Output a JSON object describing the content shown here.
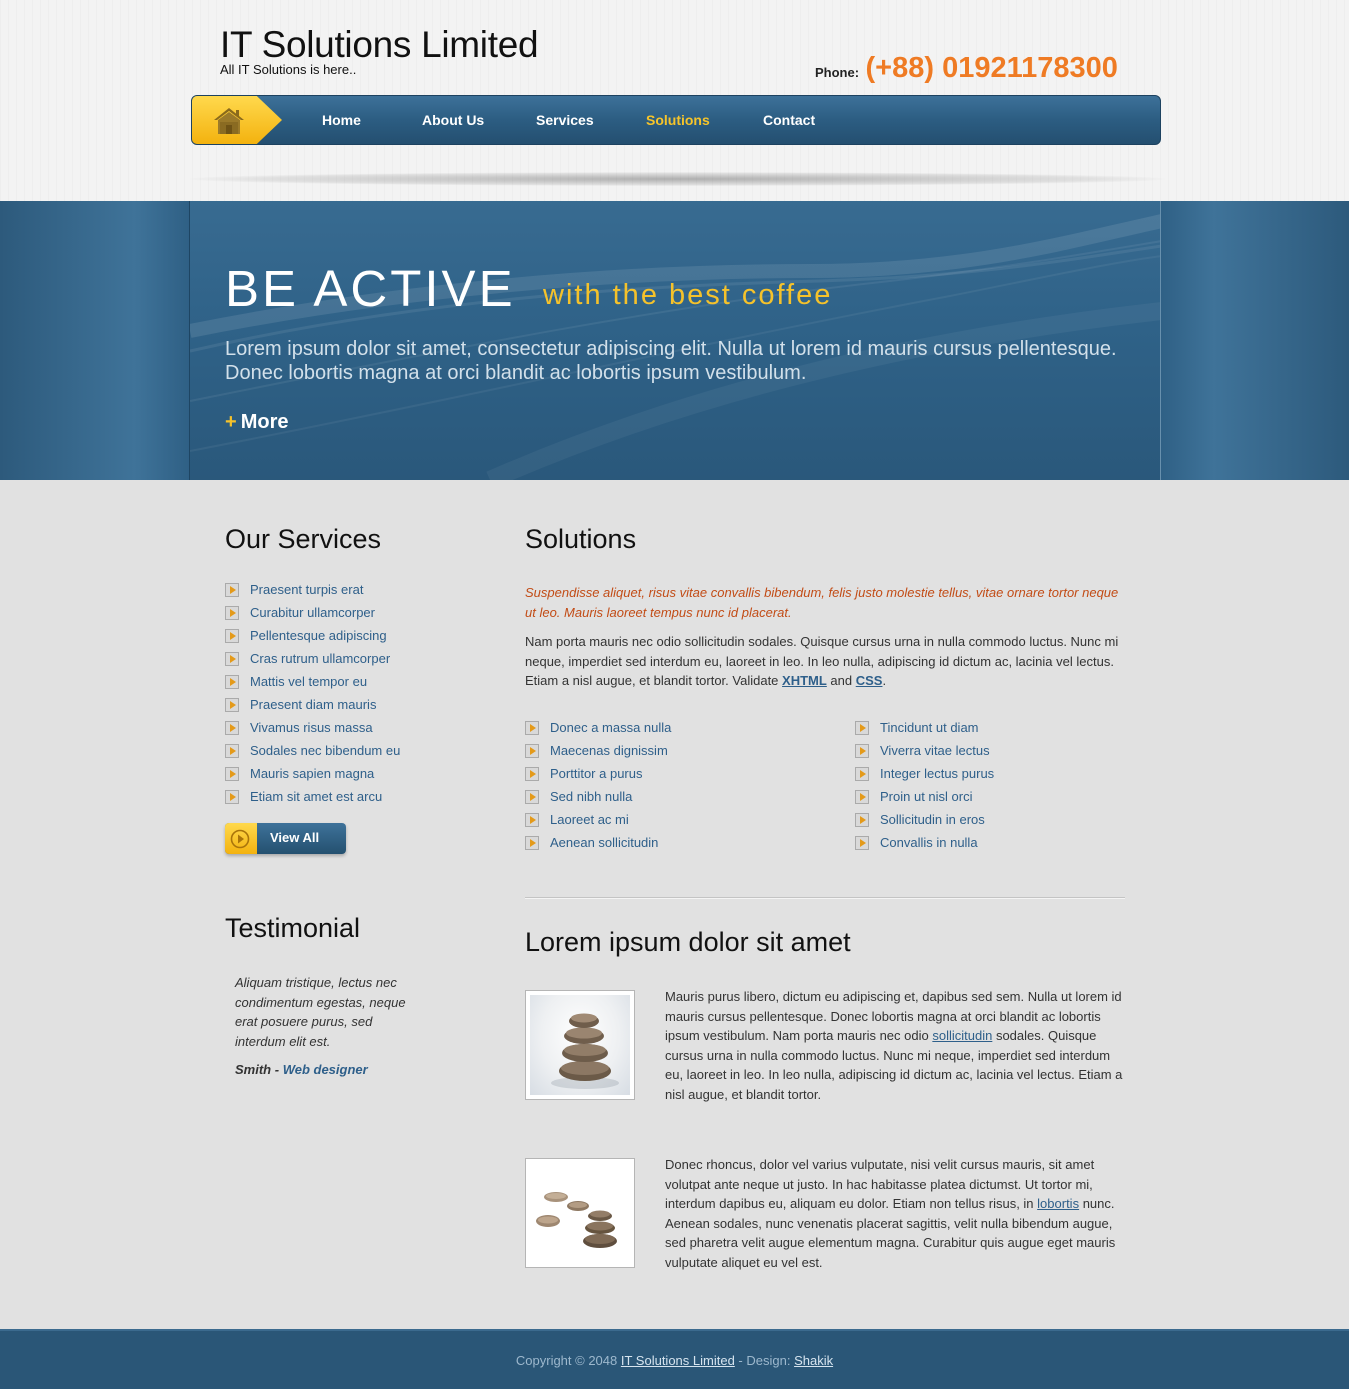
{
  "header": {
    "site_title": "IT Solutions Limited",
    "tagline": "All IT Solutions is here..",
    "phone_label": "Phone:",
    "phone_number": "(+88) 01921178300"
  },
  "nav": {
    "items": [
      {
        "label": "Home",
        "active": false
      },
      {
        "label": "About Us",
        "active": false
      },
      {
        "label": "Services",
        "active": false
      },
      {
        "label": "Solutions",
        "active": true
      },
      {
        "label": "Contact",
        "active": false
      }
    ],
    "home_icon": "house-icon"
  },
  "banner": {
    "title": "BE ACTIVE",
    "subtitle": "with the best coffee",
    "text": "Lorem ipsum dolor sit amet, consectetur adipiscing elit. Nulla ut lorem id mauris cursus pellentesque. Donec lobortis magna at orci blandit ac lobortis ipsum vestibulum.",
    "more_plus": "+",
    "more_label": "More"
  },
  "services": {
    "title": "Our Services",
    "items": [
      "Praesent turpis erat",
      "Curabitur ullamcorper",
      "Pellentesque adipiscing",
      "Cras rutrum ullamcorper",
      "Mattis vel tempor eu",
      "Praesent diam mauris",
      "Vivamus risus massa",
      "Sodales nec bibendum eu",
      "Mauris sapien magna",
      "Etiam sit amet est arcu"
    ],
    "view_all_label": "View All"
  },
  "solutions": {
    "title": "Solutions",
    "intro": "Suspendisse aliquet, risus vitae convallis bibendum, felis justo molestie tellus, vitae ornare tortor neque ut leo. Mauris laoreet tempus nunc id placerat.",
    "body_before": "Nam porta mauris nec odio sollicitudin sodales. Quisque cursus urna in nulla commodo luctus. Nunc mi neque, imperdiet sed interdum eu, laoreet in leo. In leo nulla, adipiscing id dictum ac, lacinia vel lectus. Etiam a nisl augue, et blandit tortor. Validate ",
    "link_xhtml": "XHTML",
    "body_and": " and ",
    "link_css": "CSS",
    "body_end": ".",
    "list_left": [
      "Donec a massa nulla",
      "Maecenas dignissim",
      "Porttitor a purus",
      "Sed nibh nulla",
      "Laoreet ac mi",
      "Aenean sollicitudin"
    ],
    "list_right": [
      "Tincidunt ut diam",
      "Viverra vitae lectus",
      "Integer lectus purus",
      "Proin ut nisl orci",
      "Sollicitudin in eros",
      "Convallis in nulla"
    ]
  },
  "testimonial": {
    "title": "Testimonial",
    "quote": "Aliquam tristique, lectus nec condimentum egestas, neque erat posuere purus, sed interdum elit est.",
    "author": "Smith",
    "separator": " - ",
    "role": "Web designer"
  },
  "lorem": {
    "title": "Lorem ipsum dolor sit amet",
    "para1_before": "Mauris purus libero, dictum eu adipiscing et, dapibus sed sem. Nulla ut lorem id mauris cursus pellentesque. Donec lobortis magna at orci blandit ac lobortis ipsum vestibulum. Nam porta mauris nec odio ",
    "para1_link": "sollicitudin",
    "para1_after": " sodales. Quisque cursus urna in nulla commodo luctus. Nunc mi neque, imperdiet sed interdum eu, laoreet in leo. In leo nulla, adipiscing id dictum ac, lacinia vel lectus. Etiam a nisl augue, et blandit tortor.",
    "para2_before": "Donec rhoncus, dolor vel varius vulputate, nisi velit cursus mauris, sit amet volutpat ante neque ut justo. In hac habitasse platea dictumst. Ut tortor mi, interdum dapibus eu, aliquam eu dolor. Etiam non tellus risus, in ",
    "para2_link": "lobortis",
    "para2_after": " nunc. Aenean sodales, nunc venenatis placerat sagittis, velit nulla bibendum augue, sed pharetra velit augue elementum magna. Curabitur quis augue eget mauris vulputate aliquet eu vel est."
  },
  "footer": {
    "copyright": "Copyright © 2048 ",
    "site_link": "IT Solutions Limited",
    "design_label": " - Design: ",
    "designer_link": "Shakik"
  },
  "colors": {
    "accent_orange": "#ef7b24",
    "accent_yellow": "#f5c22b",
    "brand_blue": "#2e5f8a",
    "intro_red": "#c24c16"
  }
}
